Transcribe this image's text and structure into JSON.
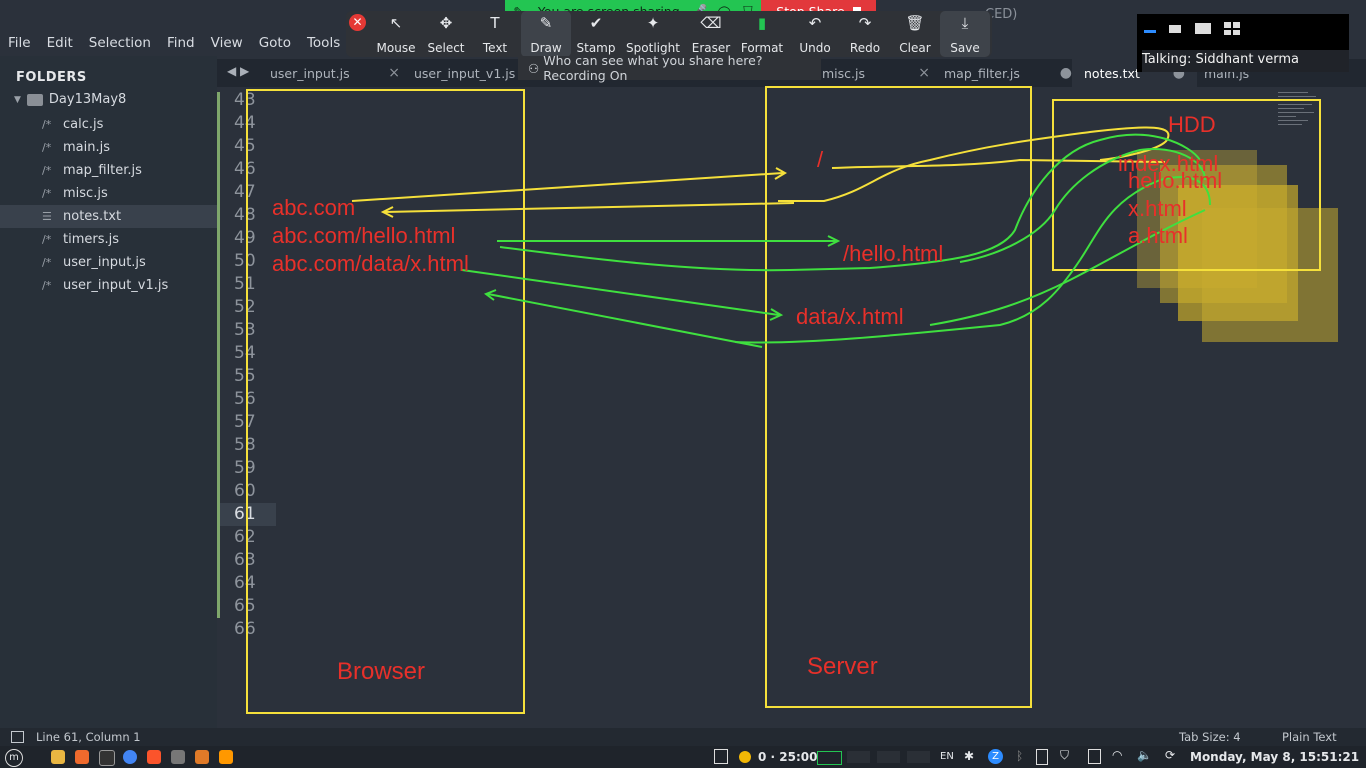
{
  "window": {
    "title_suffix": "CED)"
  },
  "menu": [
    "File",
    "Edit",
    "Selection",
    "Find",
    "View",
    "Goto",
    "Tools",
    "P"
  ],
  "sidebar": {
    "title": "FOLDERS",
    "root": "Day13May8",
    "files": [
      {
        "icon": "/*",
        "name": "calc.js"
      },
      {
        "icon": "/*",
        "name": "main.js"
      },
      {
        "icon": "/*",
        "name": "map_filter.js"
      },
      {
        "icon": "/*",
        "name": "misc.js"
      },
      {
        "icon": "☰",
        "name": "notes.txt"
      },
      {
        "icon": "/*",
        "name": "timers.js"
      },
      {
        "icon": "/*",
        "name": "user_input.js"
      },
      {
        "icon": "/*",
        "name": "user_input_v1.js"
      }
    ]
  },
  "tabs": [
    {
      "label": "user_input.js",
      "close": "×"
    },
    {
      "label": "user_input_v1.js",
      "close": ""
    },
    {
      "label": "misc.js",
      "close": "×"
    },
    {
      "label": "map_filter.js",
      "close": "●"
    },
    {
      "label": "notes.txt",
      "close": "●"
    },
    {
      "label": "main.js",
      "close": ""
    }
  ],
  "editor": {
    "line_numbers": [
      "43",
      "44",
      "45",
      "46",
      "47",
      "48",
      "49",
      "50",
      "51",
      "52",
      "53",
      "54",
      "55",
      "56",
      "57",
      "58",
      "59",
      "60",
      "61",
      "62",
      "63",
      "64",
      "65",
      "66"
    ],
    "current_line": "61"
  },
  "annotations": {
    "browser": "Browser",
    "server": "Server",
    "hdd": "HDD",
    "urls": [
      "abc.com",
      "abc.com/hello.html",
      "abc.com/data/x.html"
    ],
    "server_paths": [
      "/",
      "/hello.html",
      "data/x.html"
    ],
    "hdd_files": [
      "index.html",
      "hello.html",
      "x.html",
      "a.html"
    ],
    "colors": {
      "box": "#f5e03b",
      "text": "#e8302a",
      "arrow_yellow": "#f5e03b",
      "arrow_green": "#3fe03f"
    }
  },
  "statusbar": {
    "position": "Line 61, Column 1",
    "tab_size": "Tab Size: 4",
    "syntax": "Plain Text"
  },
  "taskbar": {
    "timer": "0 · 25:00",
    "lang": "EN",
    "clock": "Monday, May 8, 15:51:21"
  },
  "zoom": {
    "sharing_text": "You are screen sharing",
    "stop_share": "Stop Share",
    "tools": [
      {
        "icon": "↖",
        "label": "Mouse"
      },
      {
        "icon": "✥",
        "label": "Select"
      },
      {
        "icon": "T",
        "label": "Text"
      },
      {
        "icon": "✎",
        "label": "Draw"
      },
      {
        "icon": "✔",
        "label": "Stamp"
      },
      {
        "icon": "✦",
        "label": "Spotlight"
      },
      {
        "icon": "⌫",
        "label": "Eraser"
      },
      {
        "icon": "▮",
        "label": "Format"
      },
      {
        "icon": "↶",
        "label": "Undo"
      },
      {
        "icon": "↷",
        "label": "Redo"
      },
      {
        "icon": "🗑",
        "label": "Clear"
      },
      {
        "icon": "⤓",
        "label": "Save"
      }
    ],
    "who_can_see": "Who can see what you share here? Recording On",
    "talking": "Talking: Siddhant verma"
  }
}
